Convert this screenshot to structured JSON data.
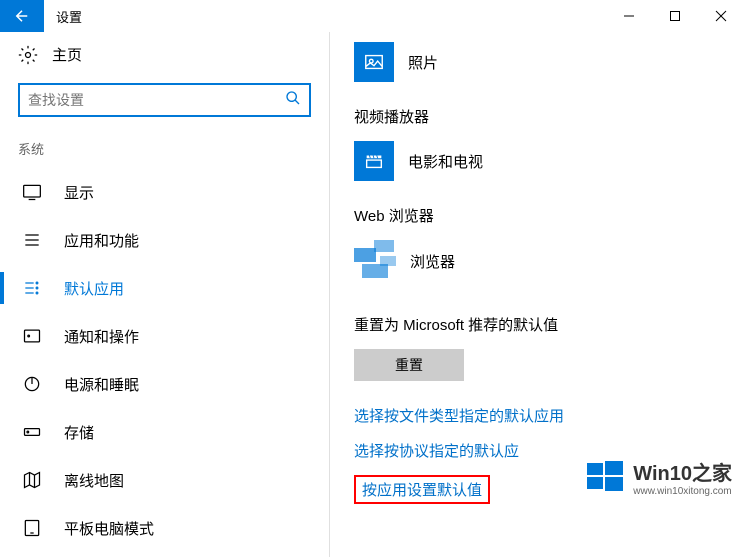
{
  "titlebar": {
    "title": "设置"
  },
  "sidebar": {
    "home_label": "主页",
    "search_placeholder": "查找设置",
    "section_label": "系统",
    "items": [
      {
        "label": "显示"
      },
      {
        "label": "应用和功能"
      },
      {
        "label": "默认应用"
      },
      {
        "label": "通知和操作"
      },
      {
        "label": "电源和睡眠"
      },
      {
        "label": "存储"
      },
      {
        "label": "离线地图"
      },
      {
        "label": "平板电脑模式"
      }
    ]
  },
  "content": {
    "photo_section": {
      "app_name": "照片"
    },
    "video_section": {
      "heading": "视频播放器",
      "app_name": "电影和电视"
    },
    "web_section": {
      "heading": "Web 浏览器",
      "app_name": "浏览器"
    },
    "reset_section": {
      "heading": "重置为 Microsoft 推荐的默认值",
      "button": "重置"
    },
    "links": {
      "by_filetype": "选择按文件类型指定的默认应用",
      "by_protocol": "选择按协议指定的默认应",
      "by_app": "按应用设置默认值"
    }
  },
  "watermark": {
    "text": "Win10之家",
    "url": "www.win10xitong.com"
  }
}
